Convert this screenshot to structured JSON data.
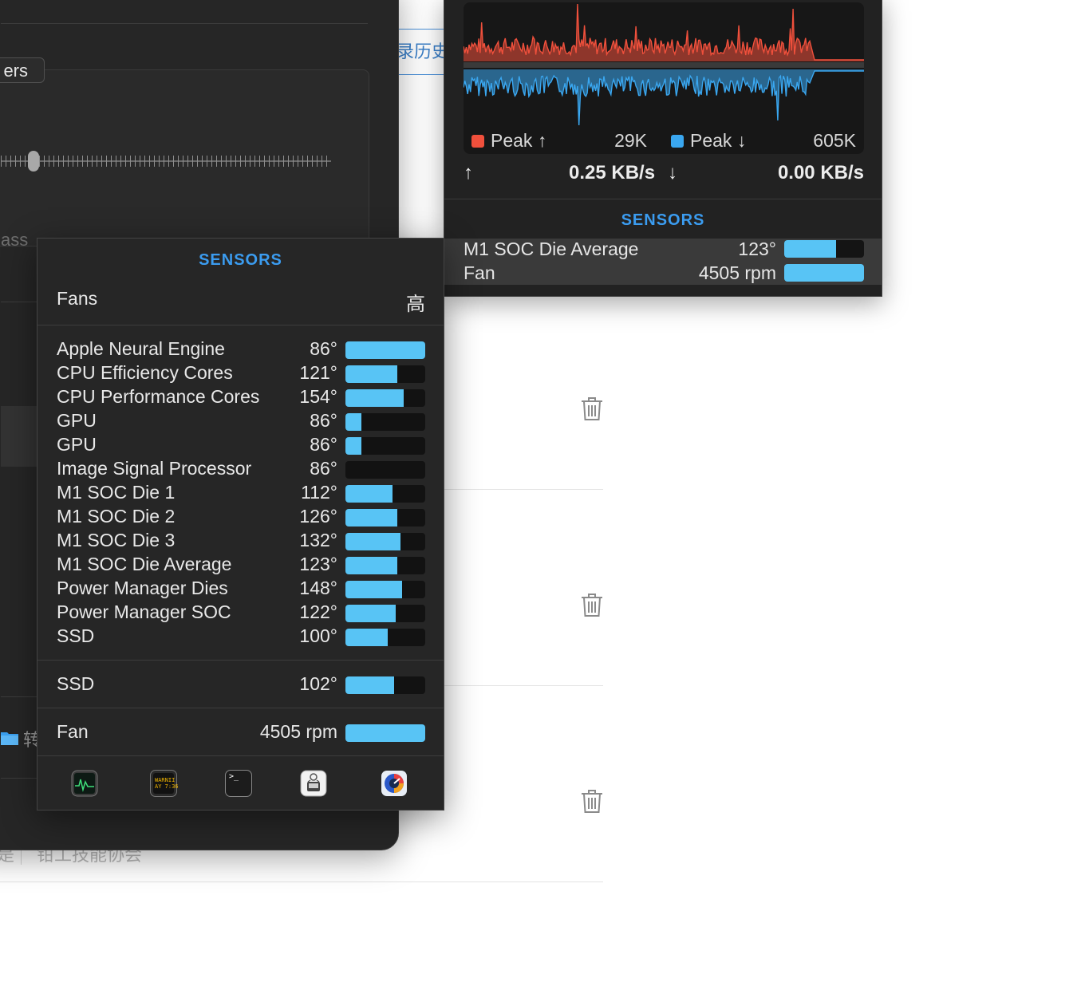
{
  "background": {
    "history_tab_label": "录历史",
    "folder_label": "转",
    "bottom_left_text": "是",
    "bottom_text": "钳工技能协会"
  },
  "back_window": {
    "pill_label": "ers",
    "truncated_label": "ass"
  },
  "network": {
    "legend": {
      "upload_label": "Peak ↑",
      "upload_value": "29K",
      "download_label": "Peak ↓",
      "download_value": "605K",
      "upload_color": "#f0503c",
      "download_color": "#3aa7f0"
    },
    "up_arrow": "↑",
    "down_arrow": "↓",
    "upload_speed": "0.25 KB/s",
    "download_speed": "0.00 KB/s",
    "sensors_header": "SENSORS",
    "sensors": [
      {
        "name": "M1 SOC Die Average",
        "value": "123°",
        "level": 0.65
      },
      {
        "name": "Fan",
        "value": "4505 rpm",
        "level": 1.0
      }
    ]
  },
  "sensors_popup": {
    "header": "SENSORS",
    "fans_label": "Fans",
    "fans_value": "高",
    "temperatures": [
      {
        "name": "Apple Neural Engine",
        "value": "86°",
        "level": 1.0
      },
      {
        "name": "CPU Efficiency Cores",
        "value": "121°",
        "level": 0.65
      },
      {
        "name": "CPU Performance Cores",
        "value": "154°",
        "level": 0.73
      },
      {
        "name": "GPU",
        "value": "86°",
        "level": 0.2
      },
      {
        "name": "GPU",
        "value": "86°",
        "level": 0.2
      },
      {
        "name": "Image Signal Processor",
        "value": "86°",
        "level": 0.0
      },
      {
        "name": "M1 SOC Die 1",
        "value": "112°",
        "level": 0.59
      },
      {
        "name": "M1 SOC Die 2",
        "value": "126°",
        "level": 0.65
      },
      {
        "name": "M1 SOC Die 3",
        "value": "132°",
        "level": 0.69
      },
      {
        "name": "M1 SOC Die Average",
        "value": "123°",
        "level": 0.65
      },
      {
        "name": "Power Manager Dies",
        "value": "148°",
        "level": 0.71
      },
      {
        "name": "Power Manager SOC",
        "value": "122°",
        "level": 0.63
      },
      {
        "name": "SSD",
        "value": "100°",
        "level": 0.53
      }
    ],
    "drive": {
      "name": "SSD",
      "value": "102°",
      "level": 0.61
    },
    "fan": {
      "name": "Fan",
      "value": "4505 rpm",
      "level": 1.0
    },
    "dock": [
      {
        "name": "activity-monitor-icon"
      },
      {
        "name": "console-icon",
        "text_line1": "WARNII",
        "text_line2": "AY 7:36"
      },
      {
        "name": "terminal-icon",
        "text": ">_"
      },
      {
        "name": "system-information-icon"
      },
      {
        "name": "istat-menus-icon"
      }
    ]
  }
}
